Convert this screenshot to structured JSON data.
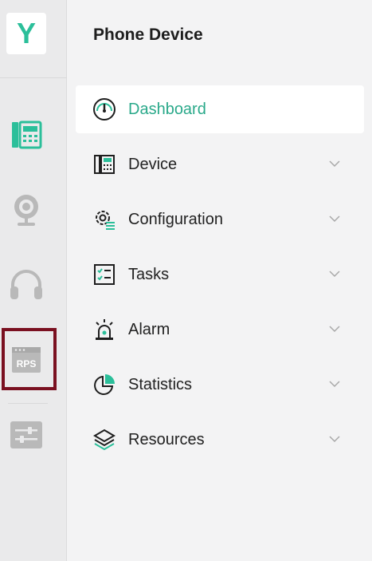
{
  "rail": {
    "logo": "Y",
    "icons": [
      {
        "name": "phone-device-icon"
      },
      {
        "name": "webcam-icon"
      },
      {
        "name": "headset-icon"
      },
      {
        "name": "rps-icon",
        "label": "RPS"
      },
      {
        "name": "settings-sliders-icon"
      }
    ],
    "selected": "rps-icon"
  },
  "panel": {
    "title": "Phone Device",
    "items": [
      {
        "label": "Dashboard",
        "icon": "dashboard-gauge-icon",
        "active": true,
        "expandable": false
      },
      {
        "label": "Device",
        "icon": "device-icon",
        "active": false,
        "expandable": true
      },
      {
        "label": "Configuration",
        "icon": "configuration-gear-icon",
        "active": false,
        "expandable": true
      },
      {
        "label": "Tasks",
        "icon": "tasks-checklist-icon",
        "active": false,
        "expandable": true
      },
      {
        "label": "Alarm",
        "icon": "alarm-icon",
        "active": false,
        "expandable": true
      },
      {
        "label": "Statistics",
        "icon": "statistics-pie-icon",
        "active": false,
        "expandable": true
      },
      {
        "label": "Resources",
        "icon": "resources-layers-icon",
        "active": false,
        "expandable": true
      }
    ]
  },
  "colors": {
    "accent": "#2bbf9a",
    "selection_border": "#7a1020",
    "icon_gray": "#b5b5b5"
  }
}
